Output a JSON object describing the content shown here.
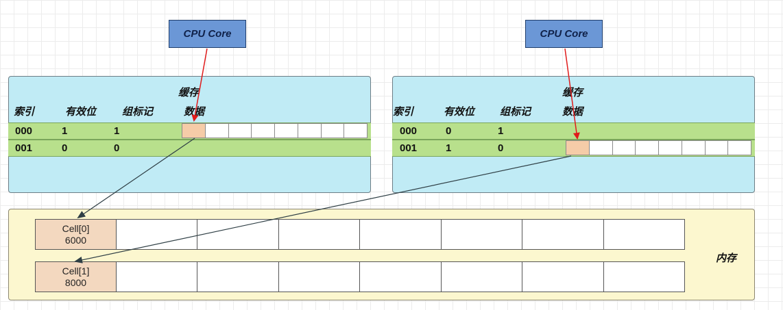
{
  "cpu_cores": [
    {
      "label": "CPU Core"
    },
    {
      "label": "CPU Core"
    }
  ],
  "caches": [
    {
      "headers": {
        "index": "索引",
        "valid": "有效位",
        "tag": "组标记",
        "data_line1": "缓存",
        "data_line2": "数据"
      },
      "rows": [
        {
          "index": "000",
          "valid": "1",
          "tag": "1"
        },
        {
          "index": "001",
          "valid": "0",
          "tag": "0"
        }
      ]
    },
    {
      "headers": {
        "index": "索引",
        "valid": "有效位",
        "tag": "组标记",
        "data_line1": "缓存",
        "data_line2": "数据"
      },
      "rows": [
        {
          "index": "000",
          "valid": "0",
          "tag": "1"
        },
        {
          "index": "001",
          "valid": "1",
          "tag": "0"
        }
      ]
    }
  ],
  "memory": {
    "label": "内存",
    "cells": [
      {
        "name": "Cell[0]",
        "value": "6000"
      },
      {
        "name": "Cell[1]",
        "value": "8000"
      }
    ]
  },
  "colors": {
    "cpu_fill": "#6b97d6",
    "cache_fill": "#c0ebf5",
    "row_fill": "#b8e08c",
    "hot_cell": "#f5cca8",
    "memory_fill": "#fcf7cf",
    "arrow_red": "#e01b1b",
    "arrow_dark": "#2f3f45"
  }
}
